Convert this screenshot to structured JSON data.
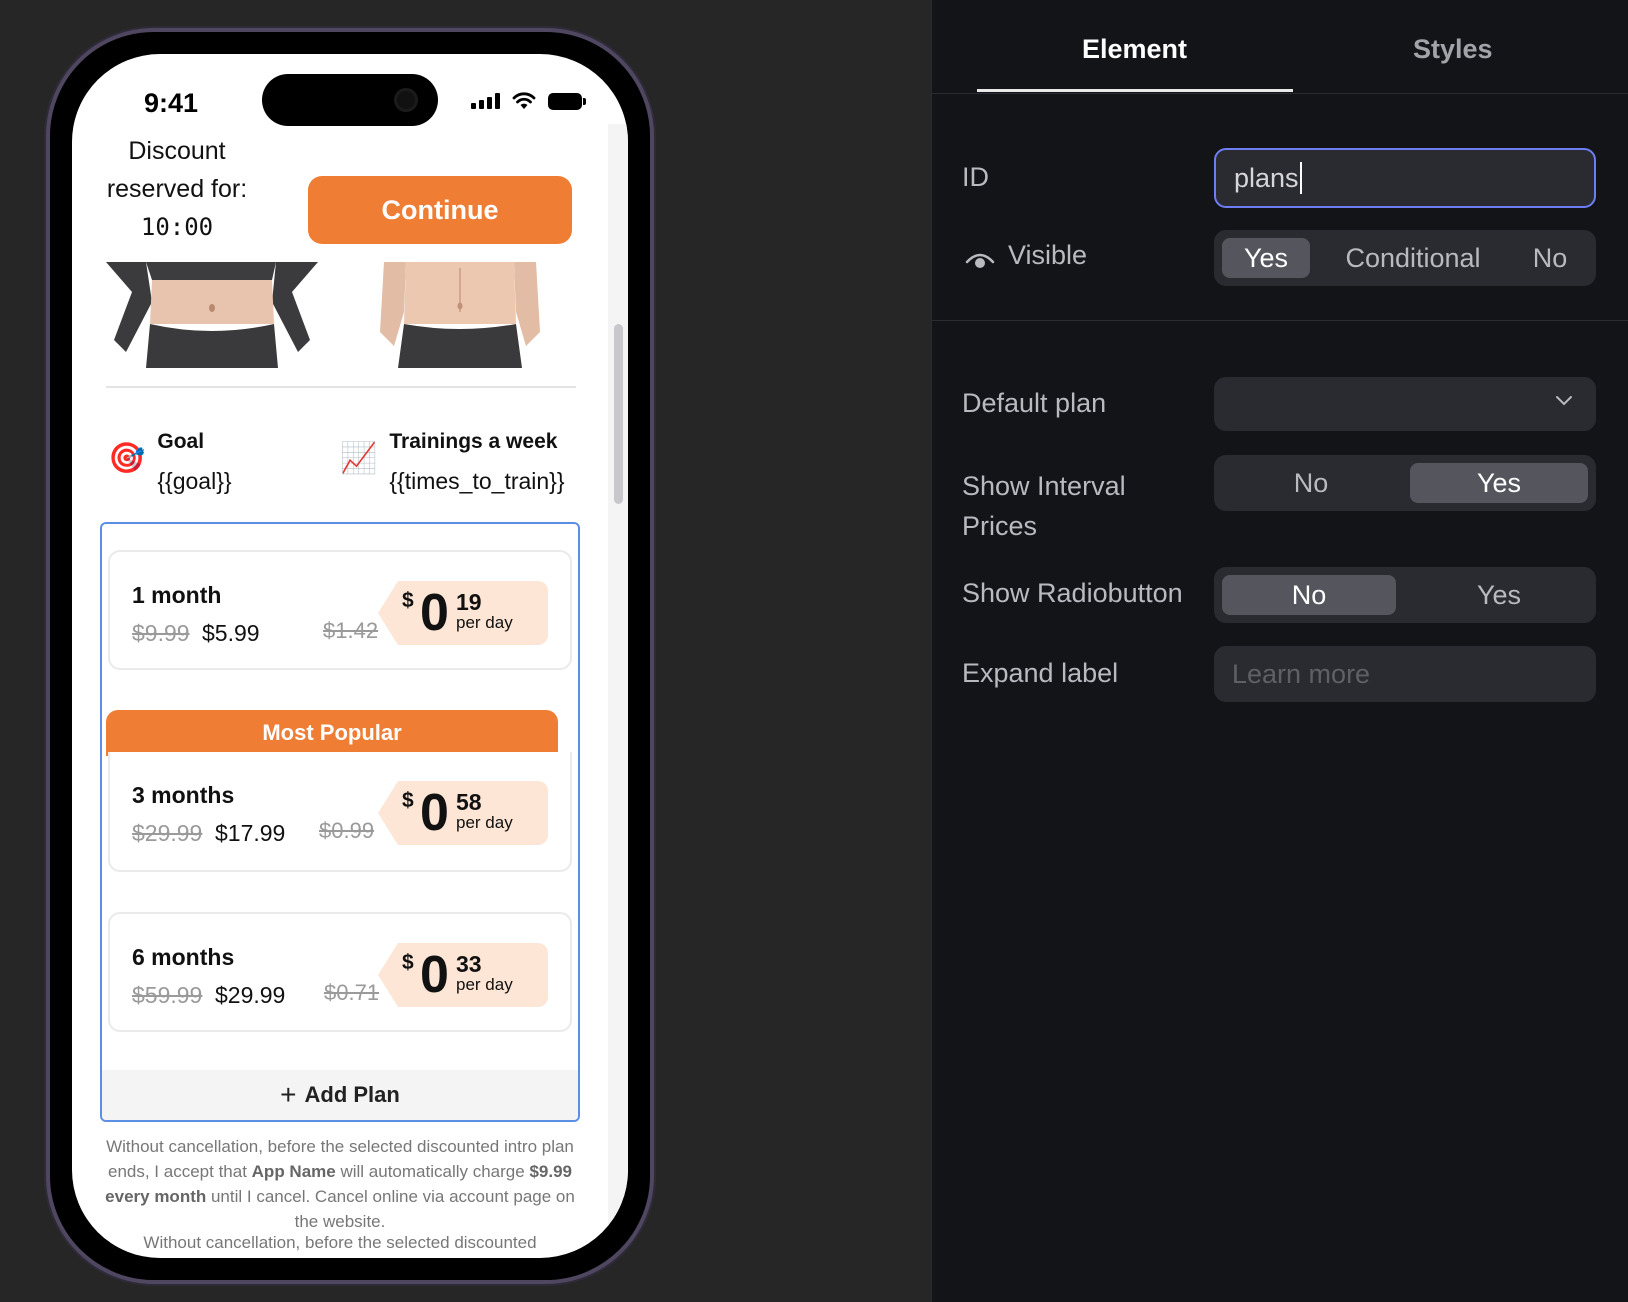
{
  "phone": {
    "status": {
      "time": "9:41"
    },
    "header": {
      "discount_line1": "Discount",
      "discount_line2": "reserved for:",
      "timer": "10:00",
      "continue_label": "Continue"
    },
    "stats": {
      "goal": {
        "icon": "🎯",
        "title": "Goal",
        "value": "{{goal}}"
      },
      "trainings": {
        "icon": "📈",
        "title": "Trainings a week",
        "value": "{{times_to_train}}"
      }
    },
    "plans": [
      {
        "name": "1 month",
        "old_price": "$9.99",
        "new_price": "$5.99",
        "old_per_day": "$1.42",
        "currency": "$",
        "int": "0",
        "frac": "19",
        "per": "per day"
      },
      {
        "name": "3 months",
        "old_price": "$29.99",
        "new_price": "$17.99",
        "old_per_day": "$0.99",
        "currency": "$",
        "int": "0",
        "frac": "58",
        "per": "per day",
        "badge": "Most Popular"
      },
      {
        "name": "6 months",
        "old_price": "$59.99",
        "new_price": "$29.99",
        "old_per_day": "$0.71",
        "currency": "$",
        "int": "0",
        "frac": "33",
        "per": "per day"
      }
    ],
    "add_plan_label": "Add Plan",
    "disclaimer": {
      "part1": "Without cancellation, before the selected discounted intro plan ends, I accept that ",
      "app_name": "App Name",
      "part2": " will automatically charge ",
      "charge": "$9.99 every month",
      "part3": " until I cancel. Cancel online via account page on the website."
    },
    "disclaimer_repeat": "Without cancellation, before the selected discounted",
    "colors": {
      "accent": "#ef7d34",
      "price_tag": "#fde6d6",
      "selection": "#5b8fe6"
    }
  },
  "panel": {
    "tabs": {
      "element": "Element",
      "styles": "Styles"
    },
    "id": {
      "label": "ID",
      "value": "plans"
    },
    "visible": {
      "label": "Visible",
      "options": [
        "Yes",
        "Conditional",
        "No"
      ],
      "selected": "Yes"
    },
    "default_plan": {
      "label": "Default plan",
      "value": ""
    },
    "show_interval_prices": {
      "label_line1": "Show Interval",
      "label_line2": "Prices",
      "options": [
        "No",
        "Yes"
      ],
      "selected": "Yes"
    },
    "show_radiobutton": {
      "label": "Show Radiobutton",
      "options": [
        "No",
        "Yes"
      ],
      "selected": "No"
    },
    "expand_label": {
      "label": "Expand label",
      "placeholder": "Learn more"
    },
    "colors": {
      "background": "#131418",
      "input": "#2a2b30",
      "focus": "#6d7ef5"
    }
  }
}
